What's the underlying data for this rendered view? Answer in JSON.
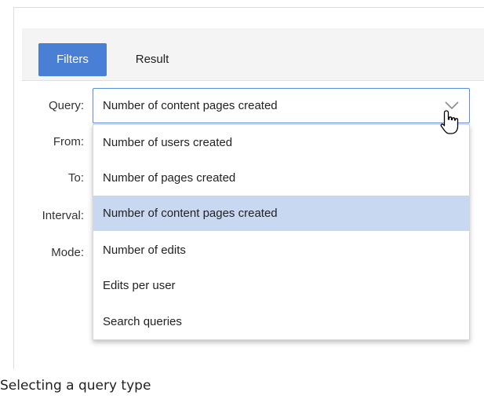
{
  "tabs": [
    {
      "label": "Filters",
      "active": true
    },
    {
      "label": "Result",
      "active": false
    }
  ],
  "form": {
    "query_label": "Query:",
    "from_label": "From:",
    "to_label": "To:",
    "interval_label": "Interval:",
    "mode_label": "Mode:",
    "query_value": "Number of content pages created"
  },
  "dropdown": {
    "options": [
      "Number of users created",
      "Number of pages created",
      "Number of content pages created",
      "Number of edits",
      "Edits per user",
      "Search queries"
    ],
    "highlighted": "Number of content pages created"
  },
  "caption": "Selecting a query type",
  "colors": {
    "accent": "#4a7fd6",
    "selected_option": "#c8d8f1",
    "select_border": "#5b8fd8"
  },
  "icons": {
    "dropdown_toggle": "chevron-down-icon",
    "pointer": "hand-pointer-icon"
  }
}
